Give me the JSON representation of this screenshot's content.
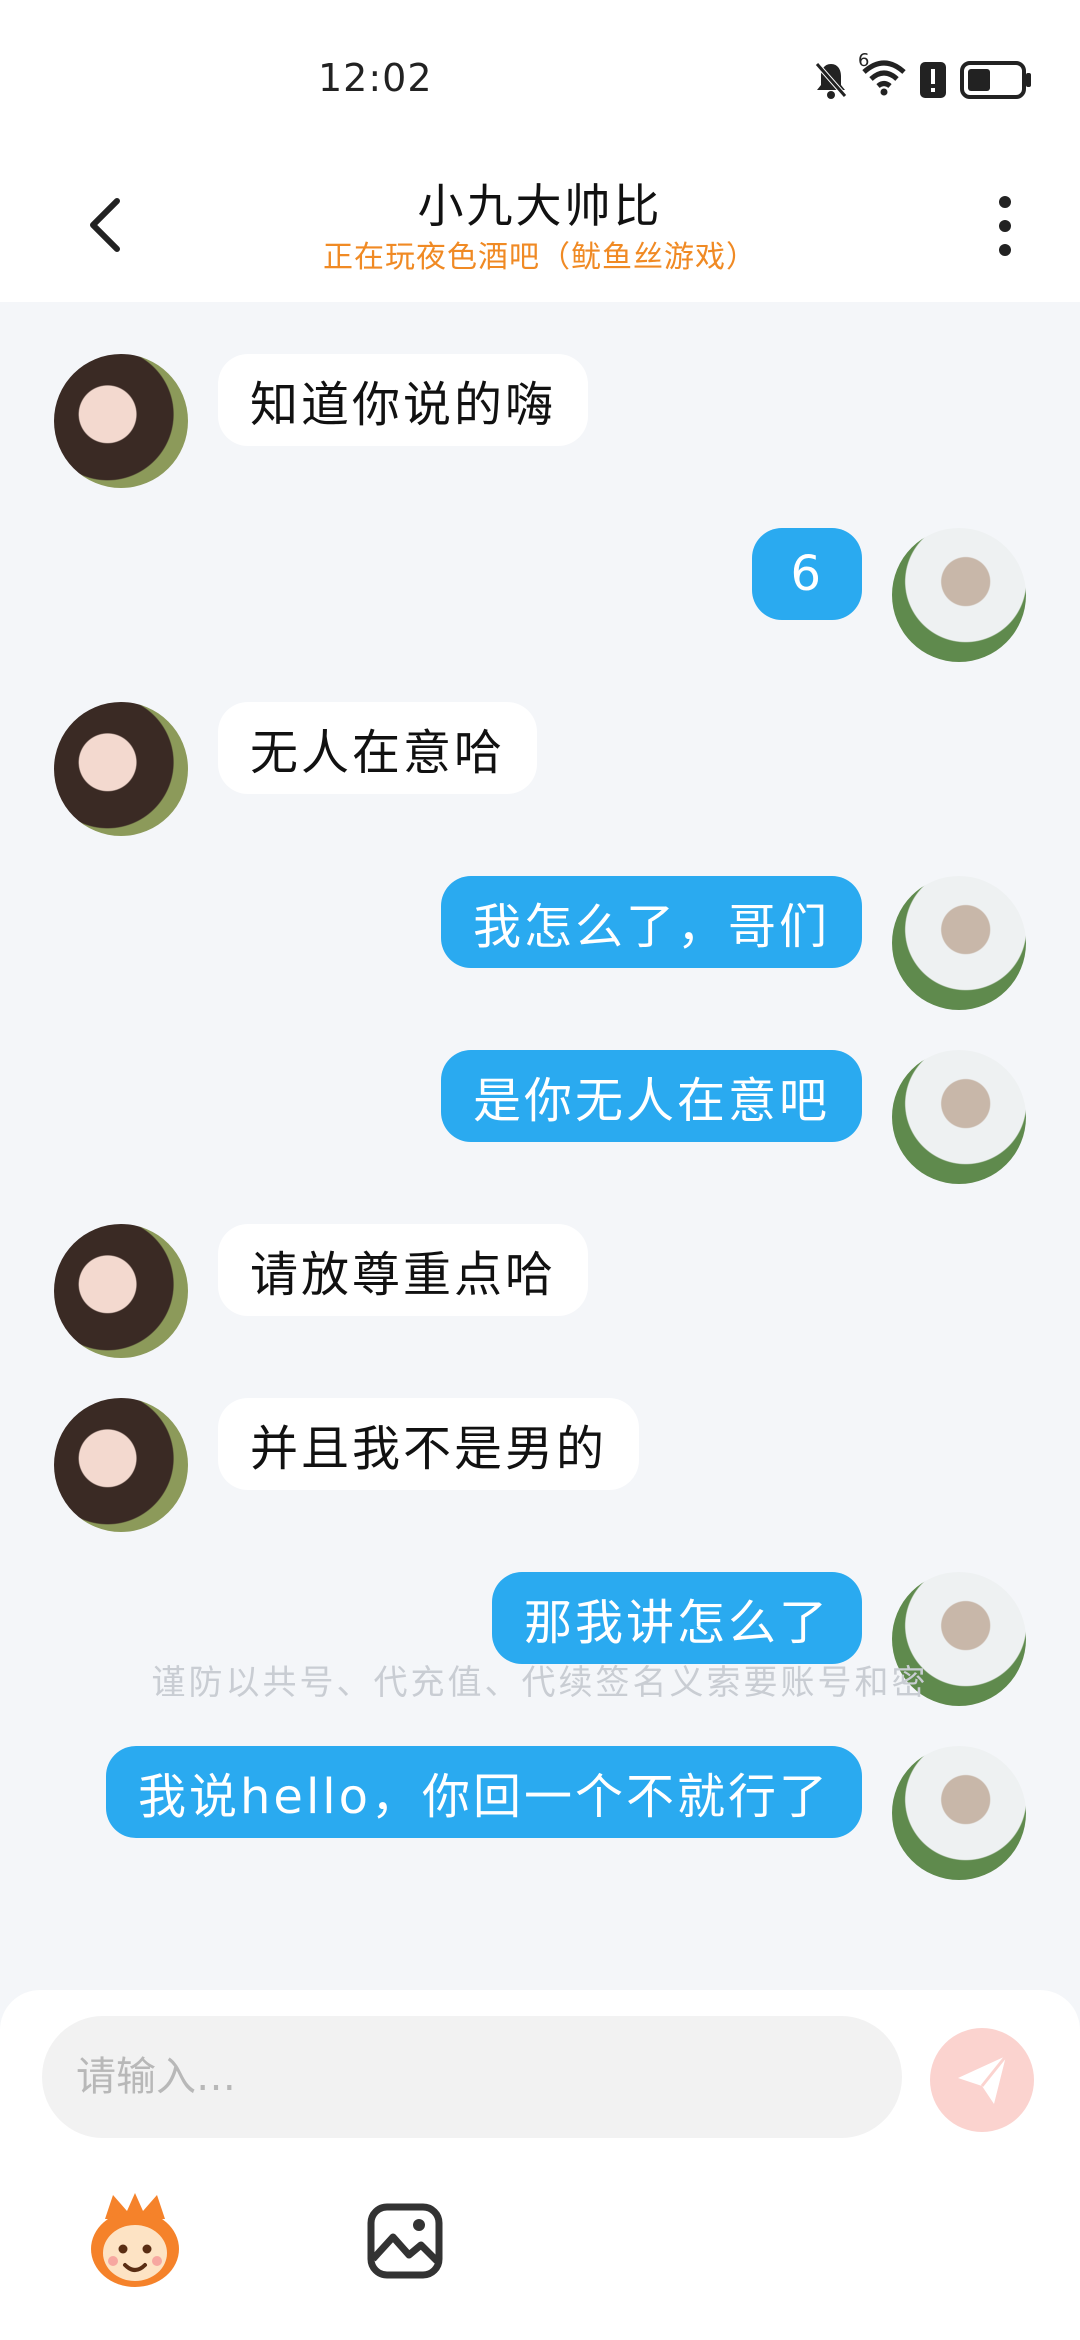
{
  "status_bar": {
    "time": "12:02",
    "icons": [
      "mute-icon",
      "wifi-icon",
      "alert-icon",
      "battery-icon"
    ],
    "wifi_badge": "6"
  },
  "header": {
    "title": "小九大帅比",
    "subtitle": "正在玩夜色酒吧（鱿鱼丝游戏）",
    "subtitle_color": "#f08a24"
  },
  "messages": [
    {
      "sender": "them",
      "text": "知道你说的嗨"
    },
    {
      "sender": "me",
      "text": "6"
    },
    {
      "sender": "them",
      "text": "无人在意哈"
    },
    {
      "sender": "me",
      "text": "我怎么了，哥们"
    },
    {
      "sender": "me",
      "text": "是你无人在意吧"
    },
    {
      "sender": "them",
      "text": "请放尊重点哈"
    },
    {
      "sender": "them",
      "text": "并且我不是男的"
    },
    {
      "sender": "me",
      "text": "那我讲怎么了"
    },
    {
      "sender": "me",
      "text": "我说hello，你回一个不就行了"
    }
  ],
  "notice": "谨防以共号、代充值、代续签名义索要账号和密",
  "input": {
    "placeholder": "请输入…",
    "value": ""
  },
  "colors": {
    "my_bubble": "#2aaaf0",
    "their_bubble": "#ffffff",
    "chat_background": "#f4f6f9",
    "send_button": "#fbd3cf"
  },
  "toolbar": {
    "icons": [
      "mascot-emoji-icon",
      "image-icon"
    ]
  }
}
